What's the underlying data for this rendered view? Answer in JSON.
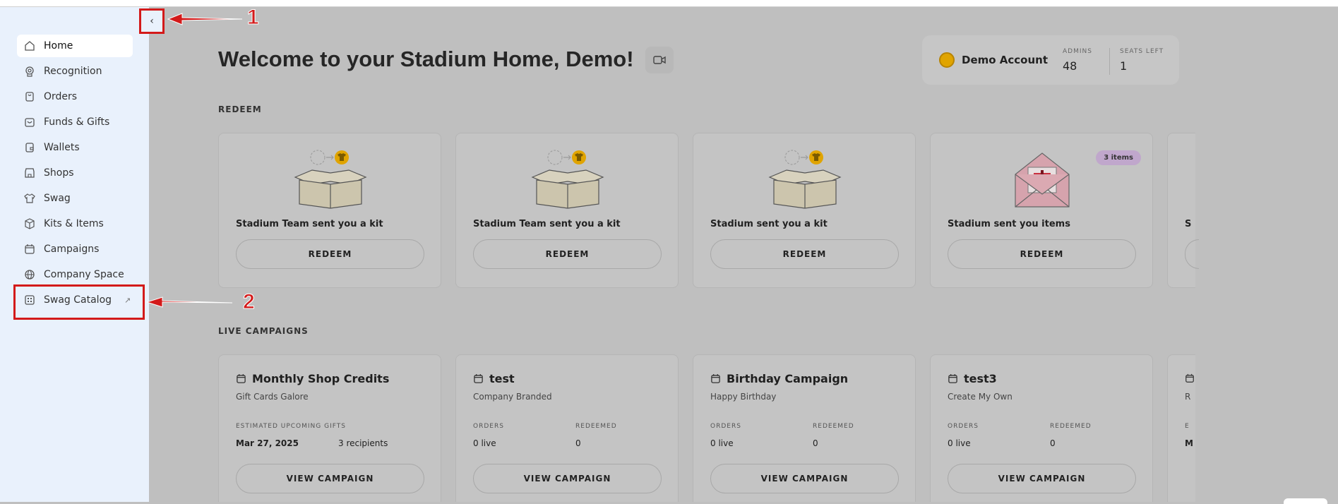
{
  "sidebar": {
    "items": [
      {
        "label": "Home",
        "icon": "home-icon"
      },
      {
        "label": "Recognition",
        "icon": "award-icon"
      },
      {
        "label": "Orders",
        "icon": "bag-icon"
      },
      {
        "label": "Funds & Gifts",
        "icon": "gift-icon"
      },
      {
        "label": "Wallets",
        "icon": "wallet-icon"
      },
      {
        "label": "Shops",
        "icon": "store-icon"
      },
      {
        "label": "Swag",
        "icon": "shirt-icon"
      },
      {
        "label": "Kits & Items",
        "icon": "box-icon"
      },
      {
        "label": "Campaigns",
        "icon": "calendar-icon"
      },
      {
        "label": "Company Space",
        "icon": "globe-icon"
      },
      {
        "label": "Swag Catalog",
        "icon": "catalog-icon",
        "external_glyph": "↗"
      }
    ],
    "collapse_glyph": "‹"
  },
  "annotations": {
    "one": "1",
    "two": "2"
  },
  "header": {
    "title": "Welcome to your Stadium Home, Demo!",
    "account_name": "Demo Account",
    "admins_label": "ADMINS",
    "admins_value": "48",
    "seats_label": "SEATS LEFT",
    "seats_value": "1"
  },
  "redeem": {
    "section_label": "REDEEM",
    "cards": [
      {
        "text": "Stadium Team sent you a kit",
        "button": "REDEEM",
        "illustration": "kit-box"
      },
      {
        "text": "Stadium Team sent you a kit",
        "button": "REDEEM",
        "illustration": "kit-box"
      },
      {
        "text": "Stadium sent you a kit",
        "button": "REDEEM",
        "illustration": "kit-box"
      },
      {
        "text": "Stadium sent you items",
        "button": "REDEEM",
        "illustration": "gift-envelope",
        "badge": "3 items"
      },
      {
        "text": "S",
        "button": "",
        "illustration": "partial"
      }
    ]
  },
  "campaigns": {
    "section_label": "LIVE CAMPAIGNS",
    "cards": [
      {
        "title": "Monthly Shop Credits",
        "subtitle": "Gift Cards Galore",
        "left_label": "ESTIMATED UPCOMING GIFTS",
        "left_value": "Mar 27, 2025",
        "right_label": "",
        "right_value": "3 recipients",
        "button": "VIEW CAMPAIGN"
      },
      {
        "title": "test",
        "subtitle": "Company Branded",
        "left_label": "ORDERS",
        "left_value": "0 live",
        "right_label": "REDEEMED",
        "right_value": "0",
        "button": "VIEW CAMPAIGN"
      },
      {
        "title": "Birthday Campaign",
        "subtitle": "Happy Birthday",
        "left_label": "ORDERS",
        "left_value": "0 live",
        "right_label": "REDEEMED",
        "right_value": "0",
        "button": "VIEW CAMPAIGN"
      },
      {
        "title": "test3",
        "subtitle": "Create My Own",
        "left_label": "ORDERS",
        "left_value": "0 live",
        "right_label": "REDEEMED",
        "right_value": "0",
        "button": "VIEW CAMPAIGN"
      },
      {
        "title": "",
        "subtitle": "R",
        "left_label": "E",
        "left_value": "M",
        "right_label": "",
        "right_value": "",
        "button": ""
      }
    ]
  },
  "colors": {
    "annotation_red": "#d31a1a",
    "sidebar_bg": "#e9f1fc",
    "overlay_gray": "#bfbfbf",
    "badge_purple": "#c0a7cc",
    "coin_gold": "#e0a400"
  }
}
